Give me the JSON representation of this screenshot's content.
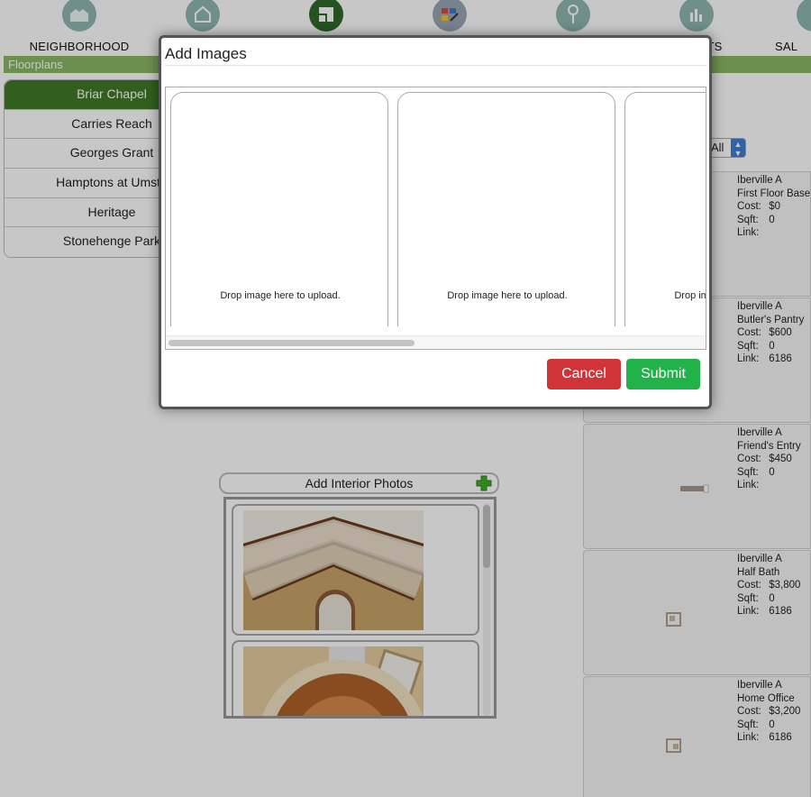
{
  "nav": {
    "items": [
      {
        "label": "NEIGHBORHOOD",
        "icon": "neighborhood-icon"
      },
      {
        "label": "",
        "icon": "home-icon"
      },
      {
        "label": "",
        "icon": "floorplan-icon"
      },
      {
        "label": "",
        "icon": "design-tools-icon"
      },
      {
        "label": "",
        "icon": "key-icon"
      },
      {
        "label": "TS",
        "icon": "reports-icon"
      },
      {
        "label": "SAL",
        "icon": "sales-icon"
      }
    ]
  },
  "section": {
    "title": "Floorplans"
  },
  "communities": [
    {
      "label": "Briar Chapel",
      "active": true
    },
    {
      "label": "Carries Reach",
      "active": false
    },
    {
      "label": "Georges Grant",
      "active": false
    },
    {
      "label": "Hamptons at Umste",
      "active": false
    },
    {
      "label": "Heritage",
      "active": false
    },
    {
      "label": "Stonehenge Park",
      "active": false
    }
  ],
  "filter": {
    "value": "All"
  },
  "options": [
    {
      "plan": "Iberville A",
      "name": "First Floor Base",
      "cost_label": "Cost:",
      "cost": "$0",
      "sqft_label": "Sqft:",
      "sqft": "0",
      "link_label": "Link:",
      "link": ""
    },
    {
      "plan": "Iberville A",
      "name": "Butler's Pantry",
      "cost_label": "Cost:",
      "cost": "$600",
      "sqft_label": "Sqft:",
      "sqft": "0",
      "link_label": "Link:",
      "link": "6186"
    },
    {
      "plan": "Iberville A",
      "name": "Friend's Entry",
      "cost_label": "Cost:",
      "cost": "$450",
      "sqft_label": "Sqft:",
      "sqft": "0",
      "link_label": "Link:",
      "link": ""
    },
    {
      "plan": "Iberville A",
      "name": "Half Bath",
      "cost_label": "Cost:",
      "cost": "$3,800",
      "sqft_label": "Sqft:",
      "sqft": "0",
      "link_label": "Link:",
      "link": "6186"
    },
    {
      "plan": "Iberville A",
      "name": "Home Office",
      "cost_label": "Cost:",
      "cost": "$3,200",
      "sqft_label": "Sqft:",
      "sqft": "0",
      "link_label": "Link:",
      "link": "6186"
    }
  ],
  "interior": {
    "title": "Add Interior Photos"
  },
  "modal": {
    "title": "Add Images",
    "dropzones": [
      {
        "text": "Drop image here to upload."
      },
      {
        "text": "Drop image here to upload."
      },
      {
        "text": "Drop image here to upload."
      }
    ],
    "cancel_label": "Cancel",
    "submit_label": "Submit"
  },
  "colors": {
    "active_community": "#3f7a26",
    "section_bar": "#8ab864",
    "cancel": "#d13438",
    "submit": "#21b24a",
    "nav_icon": "#8fb8b0"
  }
}
